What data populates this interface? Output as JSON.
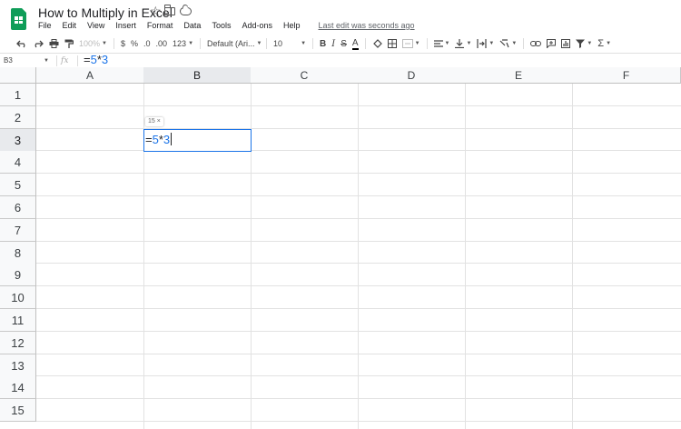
{
  "header": {
    "title": "How to Multiply in Excel",
    "menus": [
      "File",
      "Edit",
      "View",
      "Insert",
      "Format",
      "Data",
      "Tools",
      "Add-ons",
      "Help"
    ],
    "last_edit": "Last edit was seconds ago"
  },
  "toolbar": {
    "zoom": "100%",
    "currency": "$",
    "percent": "%",
    "decrease_decimal": ".0",
    "increase_decimal": ".00",
    "more_formats": "123",
    "font": "Default (Ari...",
    "font_size": "10",
    "bold": "B",
    "italic": "I",
    "strikethrough": "S",
    "text_color": "A",
    "sum": "Σ"
  },
  "formula_bar": {
    "name_box": "B3",
    "fx": "fx",
    "formula_prefix": "=",
    "formula_a": "5",
    "formula_op": "*",
    "formula_b": "3"
  },
  "grid": {
    "columns": [
      "A",
      "B",
      "C",
      "D",
      "E",
      "F"
    ],
    "rows": [
      "1",
      "2",
      "3",
      "4",
      "5",
      "6",
      "7",
      "8",
      "9",
      "10",
      "11",
      "12",
      "13",
      "14",
      "15"
    ],
    "active_column": "B",
    "active_row": "3"
  },
  "cell_editor": {
    "prefix": "=",
    "a": "5",
    "op": "*",
    "b": "3",
    "preview": "15 ×"
  },
  "colors": {
    "accent": "#1a73e8",
    "sheets_green": "#0f9d58"
  }
}
